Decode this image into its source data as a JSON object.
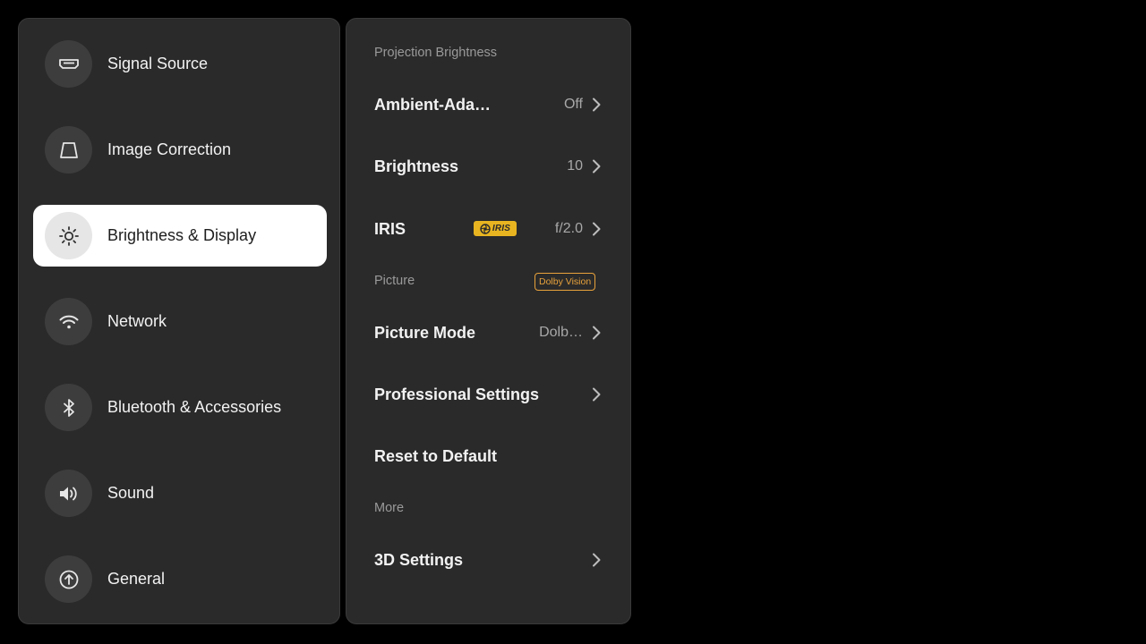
{
  "sidebar": {
    "items": [
      {
        "label": "Signal Source",
        "icon": "hdmi-port-icon"
      },
      {
        "label": "Image Correction",
        "icon": "keystone-trapezoid-icon"
      },
      {
        "label": "Brightness & Display",
        "icon": "sun-icon",
        "active": true
      },
      {
        "label": "Network",
        "icon": "wifi-icon"
      },
      {
        "label": "Bluetooth & Accessories",
        "icon": "bluetooth-icon"
      },
      {
        "label": "Sound",
        "icon": "speaker-icon"
      },
      {
        "label": "General",
        "icon": "arrow-up-circle-icon"
      }
    ]
  },
  "settings": {
    "sections": {
      "projection_brightness": "Projection Brightness",
      "picture": "Picture",
      "more": "More"
    },
    "ambient": {
      "label": "Ambient-Ada…",
      "value": "Off"
    },
    "brightness": {
      "label": "Brightness",
      "value": "10"
    },
    "iris": {
      "label": "IRIS",
      "badge": "IRIS",
      "value": "f/2.0"
    },
    "dolby_badge": "Dolby Vision",
    "picture_mode": {
      "label": "Picture Mode",
      "value": "Dolb…"
    },
    "professional": {
      "label": "Professional Settings"
    },
    "reset": {
      "label": "Reset to Default"
    },
    "three_d": {
      "label": "3D Settings"
    }
  },
  "colors": {
    "background": "#000000",
    "panel": "#2a2a2a",
    "active_item": "#ffffff",
    "iris_badge": "#e8b521",
    "dolby_badge": "#e8a23c"
  }
}
